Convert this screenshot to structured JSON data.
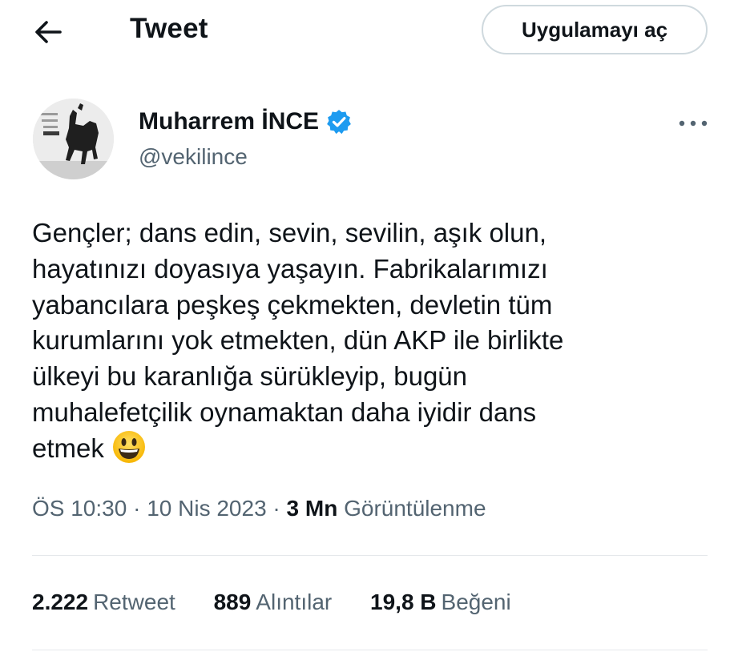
{
  "header": {
    "title": "Tweet",
    "open_app_label": "Uygulamayı aç"
  },
  "author": {
    "name": "Muharrem İNCE",
    "handle": "@vekilince"
  },
  "tweet": {
    "lines": [
      "Gençler; dans edin, sevin, sevilin, aşık olun,",
      "hayatınızı doyasıya yaşayın.  Fabrikalarımızı",
      "yabancılara peşkeş çekmekten, devletin tüm",
      "kurumlarını yok etmekten, dün AKP ile birlikte",
      "ülkeyi bu karanlığa sürükleyip, bugün",
      "muhalefetçilik oynamaktan daha iyidir dans",
      "etmek"
    ],
    "emoji": "grinning-face"
  },
  "meta": {
    "time": "ÖS 10:30",
    "separator": "·",
    "date": "10 Nis 2023",
    "views_count": "3 Mn",
    "views_label": "Görüntülenme"
  },
  "stats": {
    "retweets_count": "2.222",
    "retweets_label": "Retweet",
    "quotes_count": "889",
    "quotes_label": "Alıntılar",
    "likes_count": "19,8 B",
    "likes_label": "Beğeni"
  },
  "colors": {
    "text": "#0f1419",
    "secondary": "#536471",
    "verified": "#1d9bf0",
    "border": "#cfd9de",
    "divider": "#e5e8eb"
  }
}
